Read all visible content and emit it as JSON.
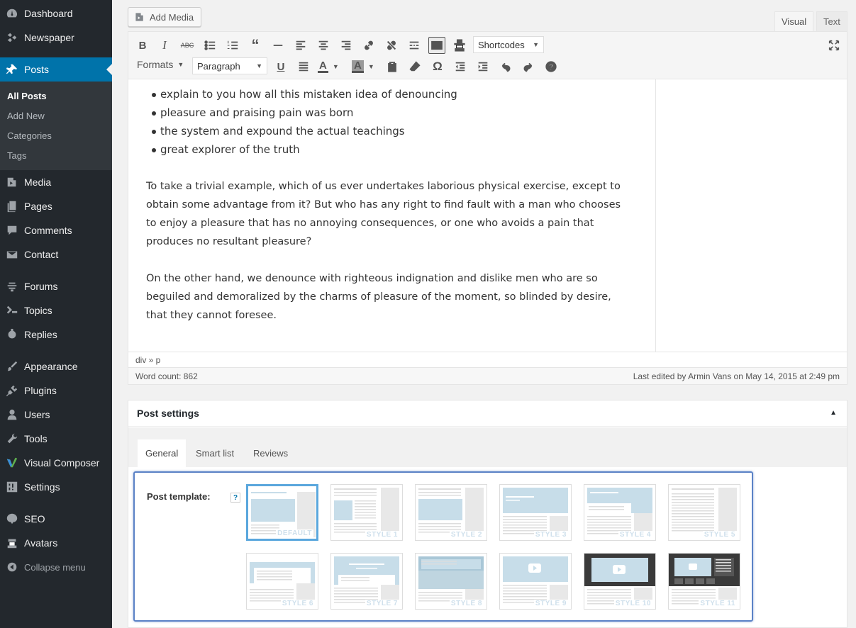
{
  "sidebar": {
    "items": [
      {
        "label": "Dashboard",
        "icon": "dashboard-icon"
      },
      {
        "label": "Newspaper",
        "icon": "newspaper-icon"
      },
      {
        "label": "Posts",
        "icon": "pin-icon"
      },
      {
        "label": "Media",
        "icon": "media-icon"
      },
      {
        "label": "Pages",
        "icon": "pages-icon"
      },
      {
        "label": "Comments",
        "icon": "comments-icon"
      },
      {
        "label": "Contact",
        "icon": "envelope-icon"
      },
      {
        "label": "Forums",
        "icon": "forums-icon"
      },
      {
        "label": "Topics",
        "icon": "topics-icon"
      },
      {
        "label": "Replies",
        "icon": "replies-icon"
      },
      {
        "label": "Appearance",
        "icon": "brush-icon"
      },
      {
        "label": "Plugins",
        "icon": "plug-icon"
      },
      {
        "label": "Users",
        "icon": "user-icon"
      },
      {
        "label": "Tools",
        "icon": "wrench-icon"
      },
      {
        "label": "Visual Composer",
        "icon": "vc-icon"
      },
      {
        "label": "Settings",
        "icon": "settings-icon"
      },
      {
        "label": "SEO",
        "icon": "seo-icon"
      },
      {
        "label": "Avatars",
        "icon": "avatar-icon"
      }
    ],
    "submenu": [
      "All Posts",
      "Add New",
      "Categories",
      "Tags"
    ],
    "collapse_label": "Collapse menu"
  },
  "editor": {
    "add_media": "Add Media",
    "tab_visual": "Visual",
    "tab_text": "Text",
    "shortcodes": "Shortcodes",
    "formats": "Formats",
    "paragraph": "Paragraph",
    "bullets": [
      "explain to you how all this mistaken idea of denouncing",
      "pleasure and praising pain was born",
      "the system and expound the actual teachings",
      "great explorer of the truth"
    ],
    "para1_lines": [
      "To take a trivial example, which of us ever undertakes laborious physical exercise, except to",
      "obtain some advantage from it? But who has any right to find fault with a man who chooses",
      "to enjoy a pleasure that has no annoying consequences, or one who avoids a pain that",
      "produces no resultant pleasure?"
    ],
    "para2_lines": [
      "On the other hand, we denounce with righteous indignation and dislike men who are so",
      "beguiled and demoralized by the charms of pleasure of the moment, so blinded by desire,",
      "that they cannot foresee."
    ],
    "path": "div » p",
    "word_count": "Word count: 862",
    "last_edited": "Last edited by Armin Vans on May 14, 2015 at 2:49 pm"
  },
  "settings": {
    "title": "Post settings",
    "tabs": [
      "General",
      "Smart list",
      "Reviews"
    ],
    "template_label": "Post template:",
    "help": "?",
    "templates": [
      "DEFAULT",
      "STYLE 1",
      "STYLE 2",
      "STYLE 3",
      "STYLE 4",
      "STYLE 5",
      "STYLE 6",
      "STYLE 7",
      "STYLE 8",
      "STYLE 9",
      "STYLE 10",
      "STYLE 11"
    ],
    "selected_template": "DEFAULT"
  },
  "colors": {
    "sidebar_bg": "#23282d",
    "active_bg": "#0073aa",
    "highlight_border": "#5b82c6",
    "thumb_blue": "#c7dde9"
  }
}
